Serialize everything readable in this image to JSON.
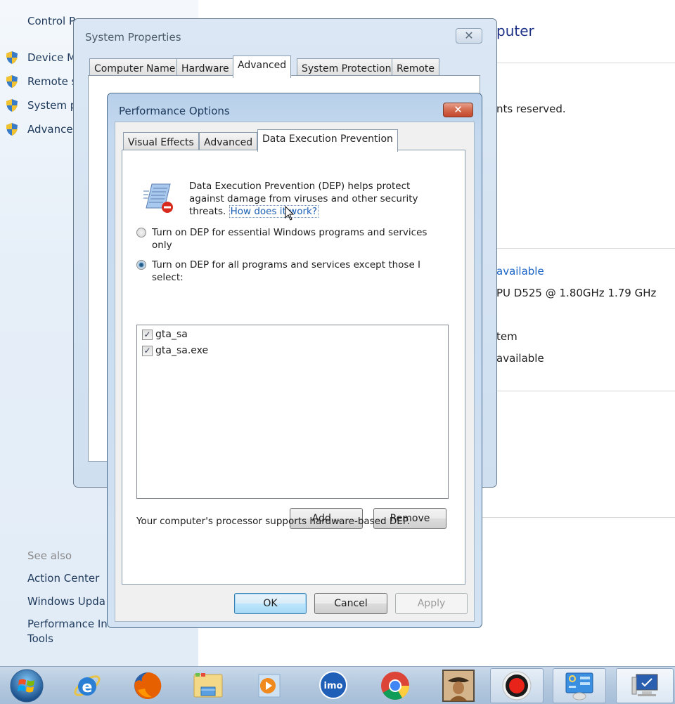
{
  "control_panel": {
    "breadcrumb_partial": "Control P",
    "left_links": [
      {
        "label": "Device M",
        "icon": "shield-icon"
      },
      {
        "label": "Remote s",
        "icon": "shield-icon"
      },
      {
        "label": "System p",
        "icon": "shield-icon"
      },
      {
        "label": "Advance",
        "icon": "shield-icon"
      }
    ],
    "see_also_heading": "See also",
    "see_also_links": [
      "Action Center",
      "Windows Upda",
      "Performance In",
      "Tools"
    ],
    "right_title_partial": "puter",
    "right_copyright_partial": "nts reserved.",
    "right_rating_partial": "available",
    "right_processor_partial": "PU D525   @ 1.80GHz   1.79 GHz",
    "right_system_type_partial": "tem",
    "right_pen_partial": "available"
  },
  "system_properties": {
    "title": "System Properties",
    "close_label": "✕",
    "tabs": [
      "Computer Name",
      "Hardware",
      "Advanced",
      "System Protection",
      "Remote"
    ],
    "active_tab": "Advanced"
  },
  "performance_options": {
    "title": "Performance Options",
    "close_label": "✕",
    "tabs": [
      "Visual Effects",
      "Advanced",
      "Data Execution Prevention"
    ],
    "active_tab": "Data Execution Prevention",
    "description": "Data Execution Prevention (DEP) helps protect against damage from viruses and other security threats.",
    "help_link": "How does it work?",
    "radio_options": [
      {
        "label": "Turn on DEP for essential Windows programs and services only",
        "checked": false
      },
      {
        "label": "Turn on DEP for all programs and services except those I select:",
        "checked": true
      }
    ],
    "exceptions": [
      {
        "name": "gta_sa",
        "checked": true
      },
      {
        "name": "gta_sa.exe",
        "checked": true
      }
    ],
    "add_button": "Add...",
    "remove_button": "Remove",
    "hardware_support_text": "Your computer's processor supports hardware-based DEP.",
    "ok_button": "OK",
    "cancel_button": "Cancel",
    "apply_button": "Apply"
  },
  "taskbar": {
    "items": [
      {
        "name": "start-button",
        "icon": "windows-logo-icon"
      },
      {
        "name": "internet-explorer",
        "icon": "internet-explorer-icon"
      },
      {
        "name": "firefox",
        "icon": "firefox-icon"
      },
      {
        "name": "windows-explorer",
        "icon": "folder-icon"
      },
      {
        "name": "media-player",
        "icon": "media-player-icon"
      },
      {
        "name": "imo",
        "icon": "imo-icon",
        "label": "imo"
      },
      {
        "name": "chrome",
        "icon": "chrome-icon"
      },
      {
        "name": "game",
        "icon": "game-character-icon"
      },
      {
        "name": "screen-recorder",
        "icon": "record-icon"
      },
      {
        "name": "control-panel",
        "icon": "control-panel-icon"
      },
      {
        "name": "system",
        "icon": "computer-icon"
      }
    ]
  }
}
